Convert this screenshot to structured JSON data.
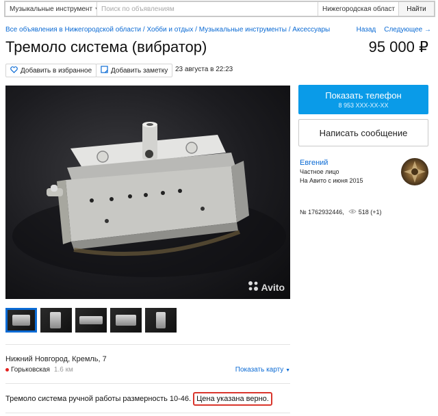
{
  "search": {
    "category": "Музыкальные инструмент",
    "placeholder": "Поиск по объявлениям",
    "region": "Нижегородская област",
    "submit_label": "Найти"
  },
  "breadcrumb": {
    "items": [
      "Все объявления в Нижегородской области",
      "Хобби и отдых",
      "Музыкальные инструменты",
      "Аксессуары"
    ],
    "separator": " / "
  },
  "nav": {
    "back": "Назад",
    "next": "Следующее →"
  },
  "listing": {
    "title": "Тремоло система (вибратор)",
    "price": "95 000 ₽",
    "favorite_label": "Добавить в избранное",
    "note_label": "Добавить заметку",
    "date": "23 августа в 22:23",
    "watermark": "Avito",
    "thumbnail_count": 5,
    "address": "Нижний Новгород, Кремль, 7",
    "metro": "Горьковская",
    "metro_distance": "1.6 км",
    "show_map": "Показать карту",
    "description_main": "Тремоло система ручной работы размерность 10-46.",
    "description_highlight": "Цена указана верно."
  },
  "contact": {
    "phone_label": "Показать телефон",
    "phone_masked": "8 953 XXX-XX-XX",
    "message_label": "Написать сообщение",
    "seller_name": "Евгений",
    "seller_type": "Частное лицо",
    "seller_since": "На Авито с июня 2015",
    "ad_number": "№ 1762932446,",
    "views": "518 (+1)"
  },
  "colors": {
    "link": "#0a6ad4",
    "phone_button": "#0a9be8",
    "highlight_border": "#d9342b",
    "metro": "#e4201e"
  }
}
